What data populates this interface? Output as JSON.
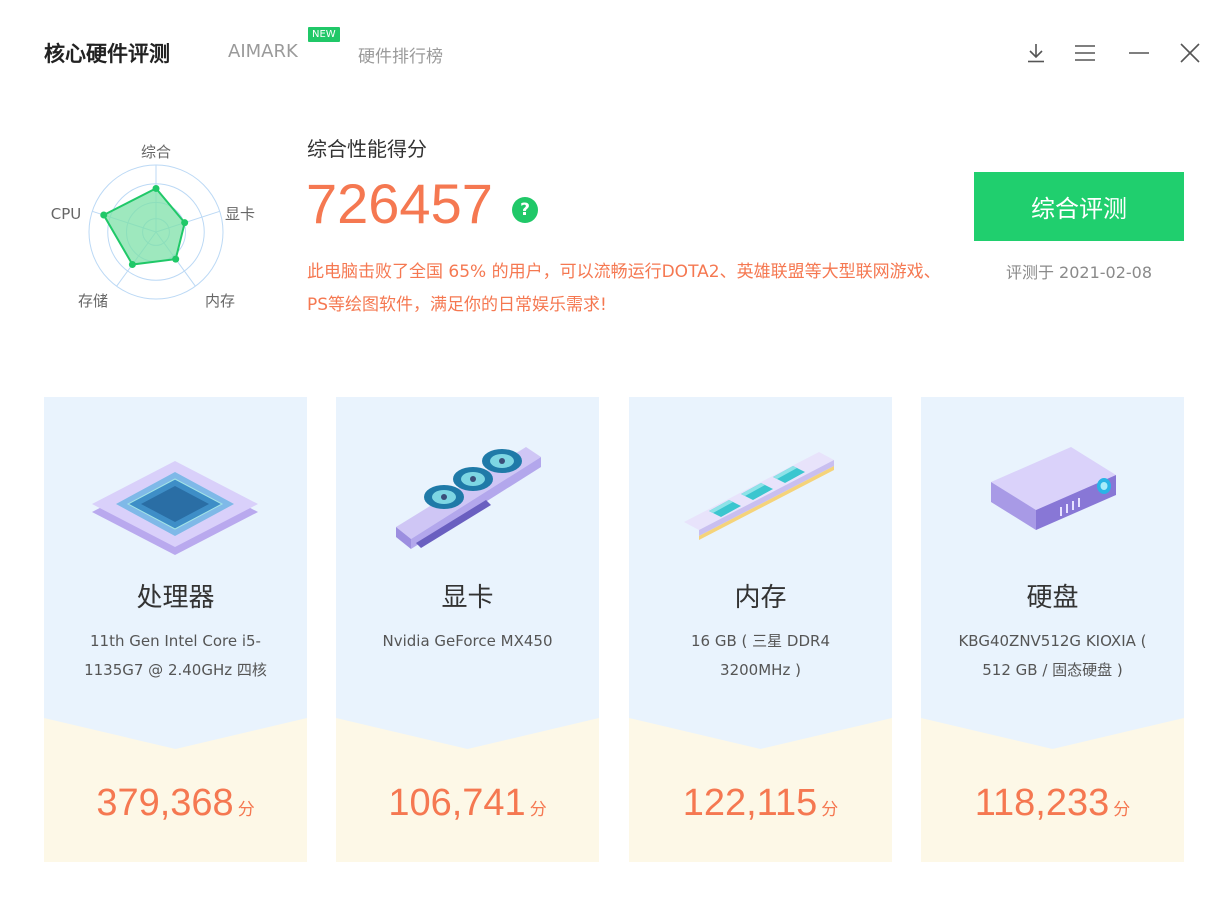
{
  "header": {
    "tabs": [
      {
        "label": "核心硬件评测",
        "active": true
      },
      {
        "label": "AIMARK",
        "badge": "NEW"
      },
      {
        "label": "硬件排行榜"
      }
    ],
    "controls": [
      "download-icon",
      "menu-icon",
      "minimize-icon",
      "close-icon"
    ]
  },
  "radar": {
    "labels": [
      "综合",
      "显卡",
      "内存",
      "存储",
      "CPU"
    ],
    "values": [
      0.65,
      0.45,
      0.5,
      0.6,
      0.82
    ],
    "fill_color": "#7ee0a8",
    "point_color": "#20c868"
  },
  "overview": {
    "title": "综合性能得分",
    "score": "726457",
    "help_icon": "?",
    "description": "此电脑击败了全国 65% 的用户，可以流畅运行DOTA2、英雄联盟等大型联网游戏、PS等绘图软件，满足你的日常娱乐需求!",
    "button_label": "综合评测",
    "date_text": "评测于 2021-02-08"
  },
  "cards": [
    {
      "title": "处理器",
      "desc": "11th Gen Intel Core i5-1135G7 @ 2.40GHz 四核",
      "score": "379,368",
      "unit": "分",
      "icon": "cpu-chip-icon"
    },
    {
      "title": "显卡",
      "desc": "Nvidia GeForce MX450",
      "score": "106,741",
      "unit": "分",
      "icon": "graphics-card-icon"
    },
    {
      "title": "内存",
      "desc": "16 GB ( 三星 DDR4 3200MHz )",
      "score": "122,115",
      "unit": "分",
      "icon": "memory-stick-icon"
    },
    {
      "title": "硬盘",
      "desc": "KBG40ZNV512G KIOXIA ( 512 GB / 固态硬盘 )",
      "score": "118,233",
      "unit": "分",
      "icon": "hard-drive-icon"
    }
  ],
  "colors": {
    "accent_green": "#20cf6e",
    "score_orange": "#f57851",
    "card_top": "#e9f3fd",
    "card_bottom": "#fdf8e7"
  }
}
